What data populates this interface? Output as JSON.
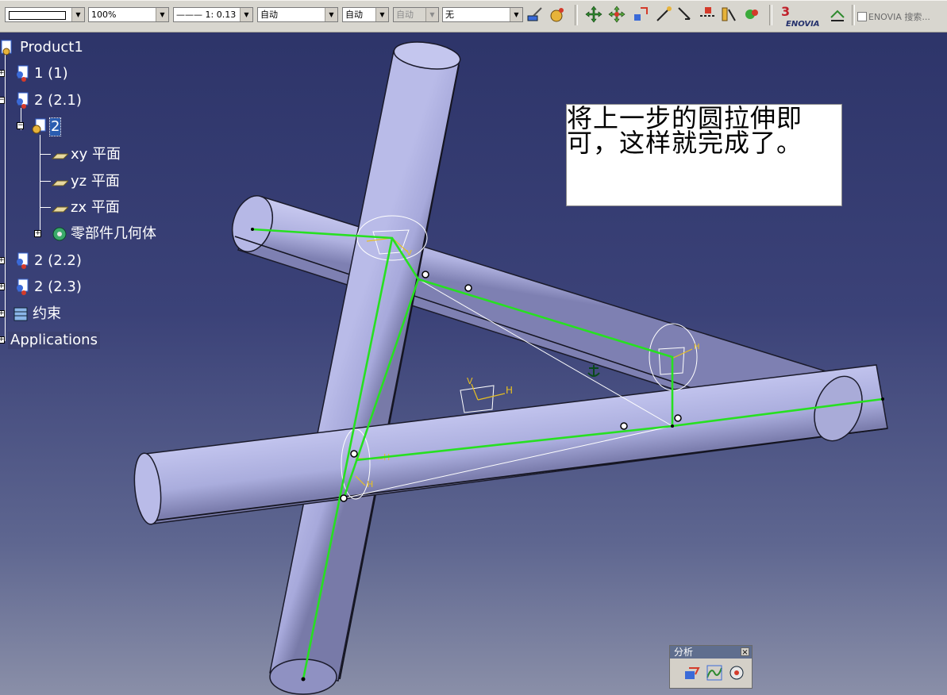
{
  "toolbar": {
    "color_combo": "",
    "transparency": "100%",
    "linetype": "——— 1: 0.13",
    "lineweight": "自动",
    "layer": "自动",
    "disabled_combo": "自动",
    "filter": "无",
    "enovia_label": "ENOVIA 搜索..."
  },
  "tree": {
    "root": "Product1",
    "items": [
      {
        "label": "1 (1)"
      },
      {
        "label": "2 (2.1)"
      },
      {
        "label": "2"
      },
      {
        "label": "xy 平面"
      },
      {
        "label": "yz 平面"
      },
      {
        "label": "zx 平面"
      },
      {
        "label": "零部件几何体"
      },
      {
        "label": "2 (2.2)"
      },
      {
        "label": "2 (2.3)"
      },
      {
        "label": "约束"
      },
      {
        "label": "Applications"
      }
    ]
  },
  "annotation": {
    "line1": "将上一步的圆拉伸即",
    "line2": "可，这样就完成了。"
  },
  "sketch_labels": {
    "h": "H",
    "v": "V"
  },
  "palette": {
    "title": "分析",
    "close": "×"
  },
  "colors": {
    "background_top": "#2c3368",
    "background_bottom": "#8a8fa8",
    "cylinder": "#b4b6e4",
    "skeleton": "#27e021",
    "selection": "#2a5db0"
  }
}
